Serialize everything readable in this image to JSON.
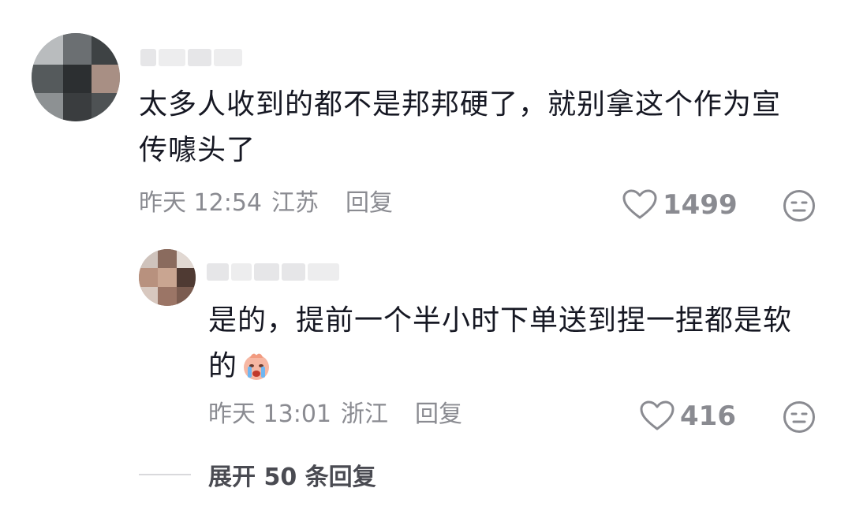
{
  "comment1": {
    "text": "太多人收到的都不是邦邦硬了，就别拿这个作为宣传噱头了",
    "time": "昨天 12:54",
    "location": "江苏",
    "reply_label": "回复",
    "likes": "1499",
    "like_icon": "heart-outline-icon",
    "dislike_icon": "meh-face-icon"
  },
  "reply1": {
    "text": "是的，提前一个半小时下单送到捏一捏都是软的",
    "emoji": "crying-face-emoji",
    "time": "昨天 13:01",
    "location": "浙江",
    "reply_label": "回复",
    "likes": "416",
    "like_icon": "heart-outline-icon",
    "dislike_icon": "meh-face-icon"
  },
  "expand": {
    "label": "展开 50 条回复"
  },
  "colors": {
    "text": "#161823",
    "muted": "#8a8b91",
    "divider": "#d9d9dc"
  }
}
